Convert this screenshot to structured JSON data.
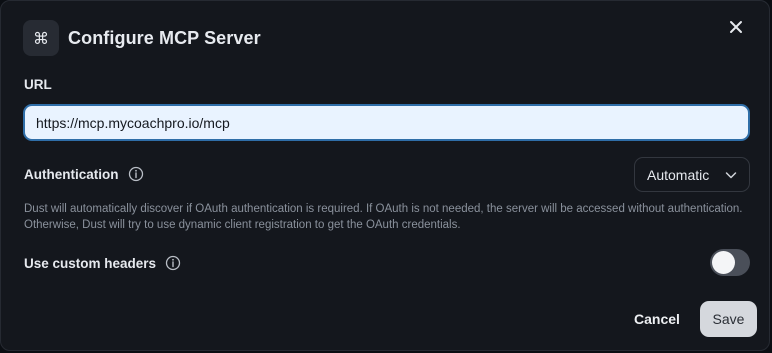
{
  "dialog": {
    "title": "Configure MCP Server",
    "header_icon": "command-icon"
  },
  "url": {
    "label": "URL",
    "value": "https://mcp.mycoachpro.io/mcp"
  },
  "authentication": {
    "label": "Authentication",
    "selected": "Automatic",
    "description": "Dust will automatically discover if OAuth authentication is required. If OAuth is not needed, the server will be accessed without authentication. Otherwise, Dust will try to use dynamic client registration to get the OAuth credentials."
  },
  "custom_headers": {
    "label": "Use custom headers",
    "enabled": false
  },
  "footer": {
    "cancel_label": "Cancel",
    "save_label": "Save"
  },
  "colors": {
    "dialog_bg": "#14171d",
    "input_bg": "#e9f3ff",
    "input_border": "#2f6ea8",
    "toggle_off": "#4a4f59",
    "save_bg": "#d5d8dd"
  }
}
